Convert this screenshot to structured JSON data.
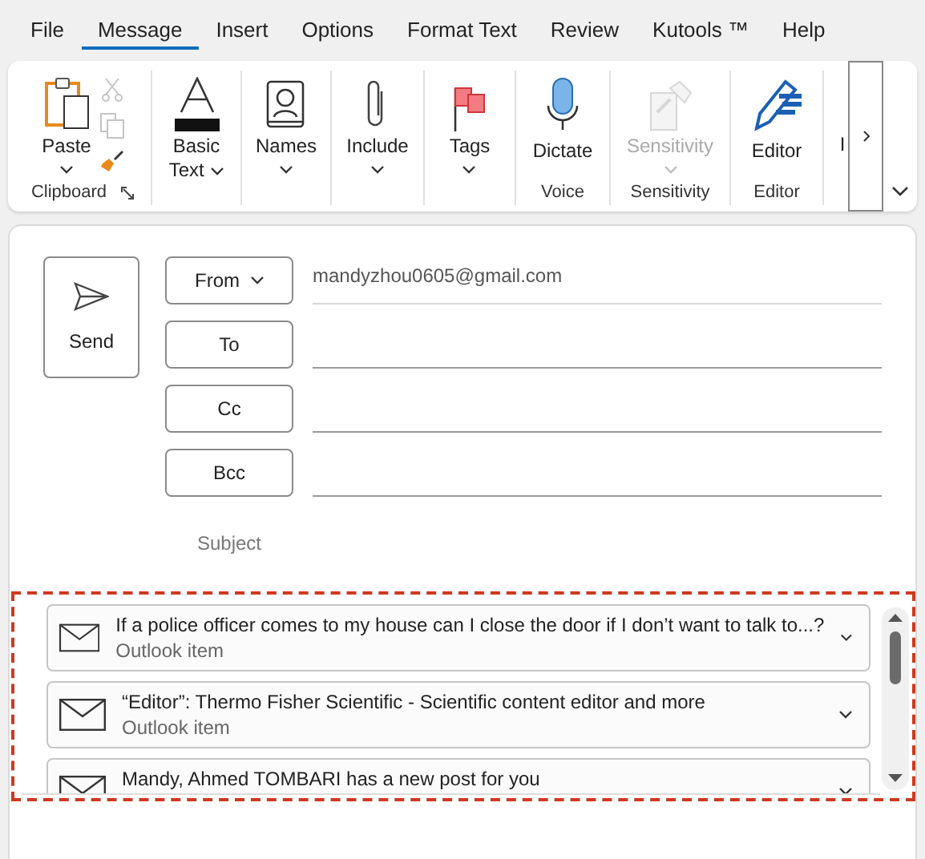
{
  "menu_tabs": [
    {
      "label": "File",
      "selected": false
    },
    {
      "label": "Message",
      "selected": true
    },
    {
      "label": "Insert",
      "selected": false
    },
    {
      "label": "Options",
      "selected": false
    },
    {
      "label": "Format Text",
      "selected": false
    },
    {
      "label": "Review",
      "selected": false
    },
    {
      "label": "Kutools ™",
      "selected": false
    },
    {
      "label": "Help",
      "selected": false
    }
  ],
  "ribbon": {
    "groups": [
      {
        "label": "Clipboard",
        "launcher": true,
        "buttons": [
          {
            "kind": "paste",
            "label": "Paste",
            "dropdown": true,
            "disabled": false
          }
        ],
        "small_buttons": [
          {
            "kind": "cut",
            "disabled": true
          },
          {
            "kind": "copy",
            "disabled": true
          },
          {
            "kind": "painter",
            "disabled": false
          }
        ]
      },
      {
        "buttons": [
          {
            "kind": "basic-text",
            "label": "Basic Text",
            "dropdown": true,
            "disabled": false
          }
        ]
      },
      {
        "buttons": [
          {
            "kind": "names",
            "label": "Names",
            "dropdown": true,
            "disabled": false
          }
        ]
      },
      {
        "buttons": [
          {
            "kind": "include",
            "label": "Include",
            "dropdown": true,
            "disabled": false
          }
        ]
      },
      {
        "buttons": [
          {
            "kind": "tags",
            "label": "Tags",
            "dropdown": true,
            "disabled": false
          }
        ]
      },
      {
        "label": "Voice",
        "buttons": [
          {
            "kind": "dictate",
            "label": "Dictate",
            "dropdown": false,
            "disabled": false
          }
        ]
      },
      {
        "label": "Sensitivity",
        "buttons": [
          {
            "kind": "sensitivity",
            "label": "Sensitivity",
            "dropdown": true,
            "disabled": true
          }
        ]
      },
      {
        "label": "Editor",
        "buttons": [
          {
            "kind": "editor",
            "label": "Editor",
            "dropdown": false,
            "disabled": false
          }
        ]
      },
      {
        "buttons": [
          {
            "kind": "partial",
            "label": "I"
          }
        ]
      }
    ]
  },
  "compose": {
    "send": {
      "label": "Send"
    },
    "fields": [
      {
        "label": "From",
        "dropdown": true,
        "value": "mandyzhou0605@gmail.com"
      },
      {
        "label": "To",
        "dropdown": false
      },
      {
        "label": "Cc",
        "dropdown": false
      },
      {
        "label": "Bcc",
        "dropdown": false
      }
    ],
    "subject": {
      "label": "Subject"
    }
  },
  "attachments": [
    {
      "title": "If a police officer comes to my house can I close the door if I don’t want to talk to...?",
      "subtitle": "Outlook item"
    },
    {
      "title": "“Editor”: Thermo Fisher Scientific - Scientific content editor and more",
      "subtitle": "Outlook item"
    },
    {
      "title": "Mandy, Ahmed TOMBARI has a new post for you"
    }
  ]
}
